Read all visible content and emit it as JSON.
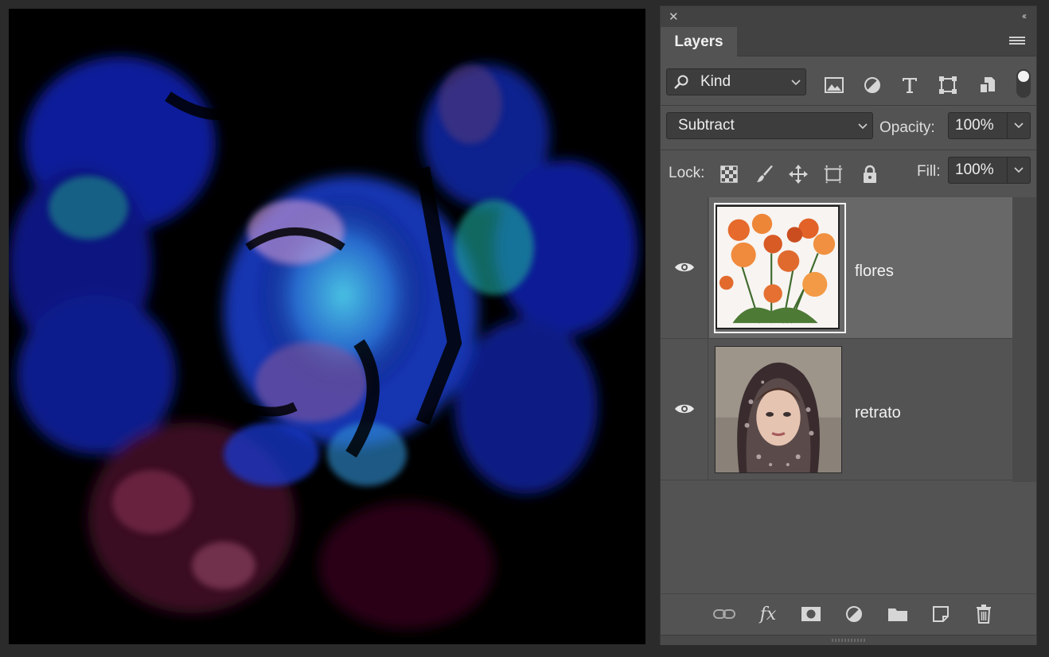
{
  "panel": {
    "tab_label": "Layers",
    "filter": {
      "kind_label": "Kind",
      "toggle_on": true
    },
    "blend_mode": "Subtract",
    "opacity_label": "Opacity:",
    "opacity_value": "100%",
    "lock_label": "Lock:",
    "fill_label": "Fill:",
    "fill_value": "100%"
  },
  "layers": [
    {
      "name": "flores",
      "visible": true,
      "selected": true
    },
    {
      "name": "retrato",
      "visible": true,
      "selected": false
    }
  ],
  "icons": {
    "top": [
      "close-icon",
      "collapse-icon",
      "panel-menu-icon"
    ],
    "filter": [
      "search-icon",
      "pixel-layer-filter-icon",
      "adjustment-layer-filter-icon",
      "type-layer-filter-icon",
      "shape-layer-filter-icon",
      "smart-object-filter-icon"
    ],
    "lock": [
      "lock-transparent-pixels-icon",
      "lock-image-pixels-icon",
      "lock-position-icon",
      "lock-artboard-icon",
      "lock-all-icon"
    ],
    "bottom": [
      "link-layers-icon",
      "fx-icon",
      "add-mask-icon",
      "new-adjustment-layer-icon",
      "new-group-icon",
      "new-layer-icon",
      "delete-layer-icon"
    ]
  },
  "colors": {
    "panel_bg": "#535353",
    "canvas_bg": "#000000",
    "selected_row": "#686868"
  }
}
